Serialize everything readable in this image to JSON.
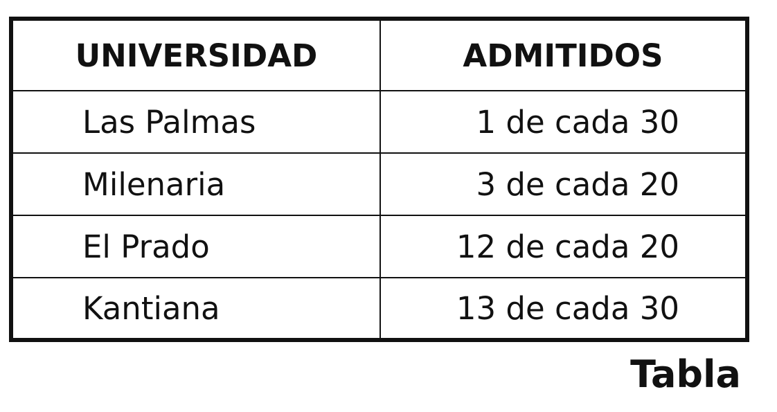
{
  "table": {
    "headers": [
      "UNIVERSIDAD",
      "ADMITIDOS"
    ],
    "rows": [
      {
        "universidad": "Las Palmas",
        "admitidos": "1 de cada 30"
      },
      {
        "universidad": "Milenaria",
        "admitidos": "3 de cada 20"
      },
      {
        "universidad": "El Prado",
        "admitidos": "12 de cada 20"
      },
      {
        "universidad": "Kantiana",
        "admitidos": "13 de cada 30"
      }
    ]
  },
  "caption": "Tabla"
}
